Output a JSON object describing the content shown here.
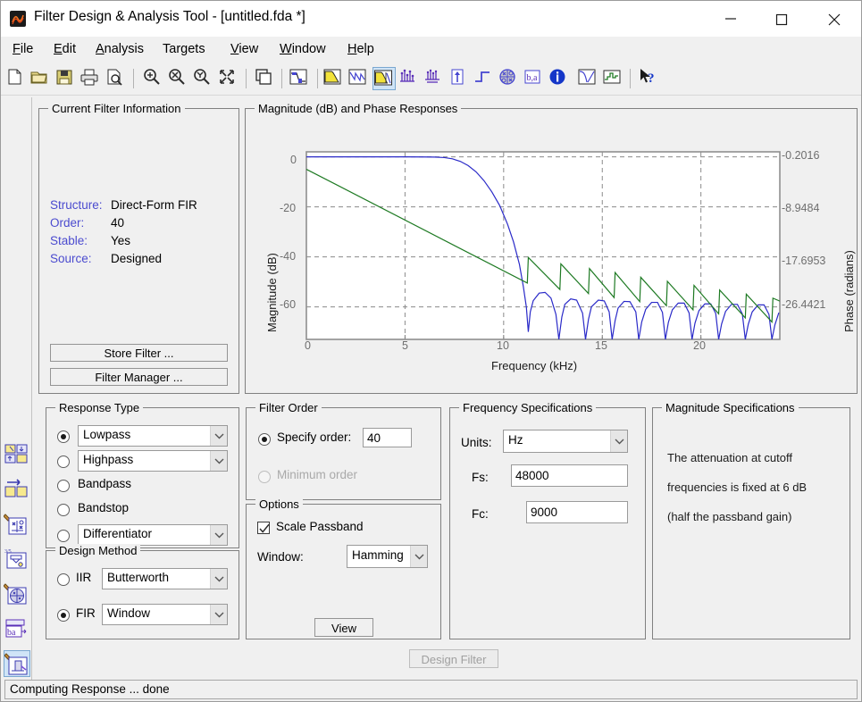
{
  "window": {
    "title": "Filter Design & Analysis Tool -  [untitled.fda *]",
    "app_icon": "matlab-membrane-icon",
    "minimize_label": "minimize-icon",
    "maximize_label": "maximize-icon",
    "close_label": "close-icon"
  },
  "menubar": {
    "items": [
      {
        "label": "File",
        "accel": "F"
      },
      {
        "label": "Edit",
        "accel": "E"
      },
      {
        "label": "Analysis",
        "accel": "A"
      },
      {
        "label": "Targets",
        "accel": "g"
      },
      {
        "label": "View",
        "accel": "V"
      },
      {
        "label": "Window",
        "accel": "W"
      },
      {
        "label": "Help",
        "accel": "H"
      }
    ]
  },
  "toolbar": {
    "buttons": [
      {
        "name": "new-filter-icon",
        "tip": "New Filter"
      },
      {
        "name": "open-folder-icon",
        "tip": "Open Session"
      },
      {
        "name": "save-icon",
        "tip": "Save Session"
      },
      {
        "name": "print-icon",
        "tip": "Print"
      },
      {
        "name": "print-preview-icon",
        "tip": "Print Preview"
      },
      {
        "name": "zoom-in-icon",
        "tip": "Zoom In"
      },
      {
        "name": "zoom-x-icon",
        "tip": "Zoom X"
      },
      {
        "name": "zoom-y-icon",
        "tip": "Zoom Y"
      },
      {
        "name": "full-view-icon",
        "tip": "Restore Default View"
      },
      {
        "name": "new-window-icon",
        "tip": "Print to Figure"
      },
      {
        "name": "filter-specifications-icon",
        "tip": "Filter Specifications"
      },
      {
        "name": "magnitude-response-icon",
        "tip": "Magnitude Response"
      },
      {
        "name": "phase-response-icon",
        "tip": "Phase Response"
      },
      {
        "name": "magnitude-and-phase-icon",
        "tip": "Magnitude and Phase Responses",
        "selected": true
      },
      {
        "name": "group-delay-icon",
        "tip": "Group Delay Response"
      },
      {
        "name": "phase-delay-icon",
        "tip": "Phase Delay"
      },
      {
        "name": "impulse-response-icon",
        "tip": "Impulse Response"
      },
      {
        "name": "step-response-icon",
        "tip": "Step Response"
      },
      {
        "name": "pole-zero-plot-icon",
        "tip": "Pole/Zero Plot"
      },
      {
        "name": "filter-coefficients-icon",
        "tip": "Filter Coefficients"
      },
      {
        "name": "filter-information-icon",
        "tip": "Filter Information"
      },
      {
        "name": "magnitude-response-estimate-icon",
        "tip": "Magnitude Response Estimate"
      },
      {
        "name": "round-off-noise-power-icon",
        "tip": "Round-off Noise Power Spectrum"
      },
      {
        "name": "context-help-icon",
        "tip": "What's This?"
      }
    ]
  },
  "sidebar": {
    "buttons": [
      {
        "name": "design-filter-icon",
        "tip": "Design Filter"
      },
      {
        "name": "import-filter-icon",
        "tip": "Import Filter"
      },
      {
        "name": "pole-zero-editor-icon",
        "tip": "Pole/Zero Editor"
      },
      {
        "name": "set-quantization-icon",
        "tip": "Set Quantization Parameters"
      },
      {
        "name": "transform-filter-icon",
        "tip": "Transform Filter"
      },
      {
        "name": "realize-model-icon",
        "tip": "Realize Model"
      },
      {
        "name": "design-multirate-icon",
        "tip": "Create a Multirate Filter",
        "selected": true
      }
    ]
  },
  "current_filter_info": {
    "title": "Current Filter Information",
    "rows": [
      {
        "key": "Structure:",
        "value": "Direct-Form FIR"
      },
      {
        "key": "Order:",
        "value": "40"
      },
      {
        "key": "Stable:",
        "value": "Yes"
      },
      {
        "key": "Source:",
        "value": "Designed"
      }
    ],
    "store_filter_button": "Store Filter ...",
    "filter_manager_button": "Filter Manager ..."
  },
  "response_panel": {
    "title": "Magnitude (dB) and Phase Responses"
  },
  "response_type": {
    "title": "Response Type",
    "options": [
      {
        "label": "Lowpass",
        "selected": true,
        "combo": true
      },
      {
        "label": "Highpass",
        "selected": false,
        "combo": true
      },
      {
        "label": "Bandpass",
        "selected": false,
        "combo": false
      },
      {
        "label": "Bandstop",
        "selected": false,
        "combo": false
      },
      {
        "label": "Differentiator",
        "selected": false,
        "combo": true
      }
    ]
  },
  "design_method": {
    "title": "Design Method",
    "options": [
      {
        "label": "IIR",
        "selected": false,
        "value": "Butterworth"
      },
      {
        "label": "FIR",
        "selected": true,
        "value": "Window"
      }
    ]
  },
  "filter_order": {
    "title": "Filter Order",
    "specify_order_label": "Specify order:",
    "specify_order_selected": true,
    "order_value": "40",
    "minimum_order_label": "Minimum order",
    "minimum_order_selected": false,
    "minimum_order_disabled": true
  },
  "options": {
    "title": "Options",
    "scale_passband_label": "Scale Passband",
    "scale_passband_checked": true,
    "window_label": "Window:",
    "window_value": "Hamming",
    "view_button": "View"
  },
  "frequency_specifications": {
    "title": "Frequency Specifications",
    "units_label": "Units:",
    "units_value": "Hz",
    "fs_label": "Fs:",
    "fs_value": "48000",
    "fc_label": "Fc:",
    "fc_value": "9000"
  },
  "magnitude_specifications": {
    "title": "Magnitude Specifications",
    "lines": [
      "The attenuation at cutoff",
      "frequencies is fixed at 6 dB",
      "(half the passband gain)"
    ]
  },
  "design_filter_button": {
    "label": "Design Filter",
    "disabled": true
  },
  "statusbar": {
    "text": "Computing Response ... done"
  },
  "chart_data": {
    "type": "line",
    "title": "Magnitude (dB) and Phase Responses",
    "xlabel": "Frequency (kHz)",
    "ylabel": "Magnitude (dB)",
    "y2label": "Phase (radians)",
    "xlim": [
      0,
      24
    ],
    "xticks": [
      0,
      5,
      10,
      15,
      20
    ],
    "ylim": [
      -73,
      2
    ],
    "yticks": [
      0,
      -20,
      -40,
      -60
    ],
    "y2ticks": [
      "-0.2016",
      "-8.9484",
      "-17.6953",
      "-26.4421"
    ],
    "y2lim": [
      -29.5,
      2.8
    ],
    "grid": true,
    "legend": "none",
    "series": [
      {
        "name": "Magnitude (dB)",
        "color": "#2a2ac8",
        "axis": "left",
        "x": [
          0.0,
          1.0,
          2.0,
          3.0,
          4.0,
          5.0,
          6.0,
          6.5,
          7.0,
          7.4,
          7.8,
          8.2,
          8.6,
          9.0,
          9.4,
          9.8,
          10.2,
          10.5,
          10.8,
          11.0,
          11.15,
          11.25,
          11.35,
          11.5,
          11.8,
          12.1,
          12.4,
          12.65,
          12.8,
          12.95,
          13.1,
          13.4,
          13.7,
          14.0,
          14.15,
          14.3,
          14.45,
          14.8,
          15.1,
          15.35,
          15.5,
          15.65,
          15.8,
          16.1,
          16.4,
          16.7,
          16.85,
          17.0,
          17.2,
          17.5,
          17.8,
          18.05,
          18.2,
          18.35,
          18.55,
          18.85,
          19.15,
          19.4,
          19.55,
          19.7,
          19.9,
          20.2,
          20.5,
          20.75,
          20.9,
          21.05,
          21.25,
          21.55,
          21.85,
          22.1,
          22.25,
          22.4,
          22.6,
          22.9,
          23.2,
          23.45,
          23.6,
          23.75,
          23.95
        ],
        "y": [
          0.0,
          0.0,
          0.0,
          0.0,
          0.0,
          0.0,
          -0.05,
          -0.1,
          -0.3,
          -0.8,
          -1.8,
          -3.5,
          -6.0,
          -9.5,
          -14.0,
          -19.5,
          -27.0,
          -34.0,
          -43.0,
          -52.0,
          -60.0,
          -70.0,
          -62.0,
          -57.5,
          -54.5,
          -54.2,
          -56.5,
          -63.0,
          -73.0,
          -64.0,
          -59.0,
          -56.8,
          -57.3,
          -62.5,
          -73.0,
          -65.0,
          -60.0,
          -57.3,
          -57.6,
          -62.0,
          -73.0,
          -65.5,
          -60.5,
          -57.8,
          -57.9,
          -62.0,
          -73.0,
          -66.0,
          -61.0,
          -58.2,
          -58.2,
          -62.2,
          -73.0,
          -66.2,
          -61.2,
          -58.5,
          -58.5,
          -62.4,
          -73.0,
          -66.5,
          -61.5,
          -58.8,
          -58.8,
          -62.6,
          -73.0,
          -66.8,
          -61.8,
          -59.0,
          -59.0,
          -62.8,
          -73.0,
          -67.0,
          -62.0,
          -59.2,
          -59.2,
          -63.0,
          -73.0,
          -67.2,
          -62.3
        ]
      },
      {
        "name": "Phase (radians)",
        "color": "#1e7a23",
        "axis": "right",
        "x": [
          0.0,
          11.2,
          11.25,
          12.85,
          12.9,
          14.3,
          14.35,
          15.6,
          15.65,
          16.9,
          16.95,
          18.25,
          18.3,
          19.6,
          19.65,
          20.9,
          20.95,
          22.25,
          22.3,
          23.6,
          23.65,
          24.0
        ],
        "y": [
          -0.2016,
          -19.8,
          -15.4,
          -20.9,
          -16.5,
          -21.6,
          -17.3,
          -22.3,
          -18.0,
          -23.0,
          -18.8,
          -23.7,
          -19.5,
          -24.4,
          -20.2,
          -25.1,
          -21.0,
          -25.8,
          -21.7,
          -26.5,
          -22.4,
          -22.9
        ]
      }
    ]
  }
}
